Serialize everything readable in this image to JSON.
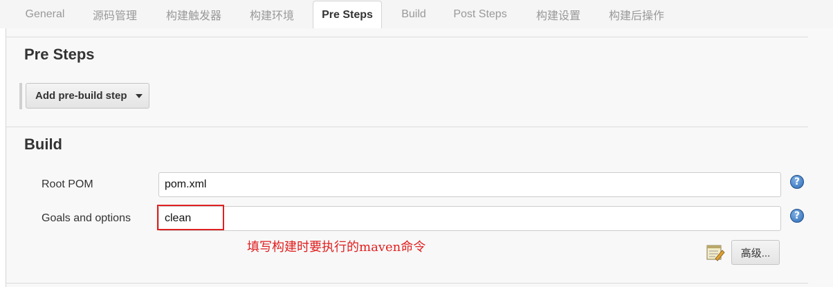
{
  "tabs": [
    {
      "label": "General",
      "active": false
    },
    {
      "label": "源码管理",
      "active": false
    },
    {
      "label": "构建触发器",
      "active": false
    },
    {
      "label": "构建环境",
      "active": false
    },
    {
      "label": "Pre Steps",
      "active": true
    },
    {
      "label": "Build",
      "active": false
    },
    {
      "label": "Post Steps",
      "active": false
    },
    {
      "label": "构建设置",
      "active": false
    },
    {
      "label": "构建后操作",
      "active": false
    }
  ],
  "pre_steps": {
    "title": "Pre Steps",
    "add_button_label": "Add pre-build step"
  },
  "build": {
    "title": "Build",
    "root_pom": {
      "label": "Root POM",
      "value": "pom.xml"
    },
    "goals": {
      "label": "Goals and options",
      "value": "clean"
    },
    "help_icon": "?",
    "advanced_button_label": "高级..."
  },
  "annotation": {
    "text": "填写构建时要执行的maven命令",
    "color": "#e02020"
  },
  "icons": {
    "help": "help-icon",
    "notepad": "notepad-icon",
    "dropdown": "caret-down-icon"
  }
}
